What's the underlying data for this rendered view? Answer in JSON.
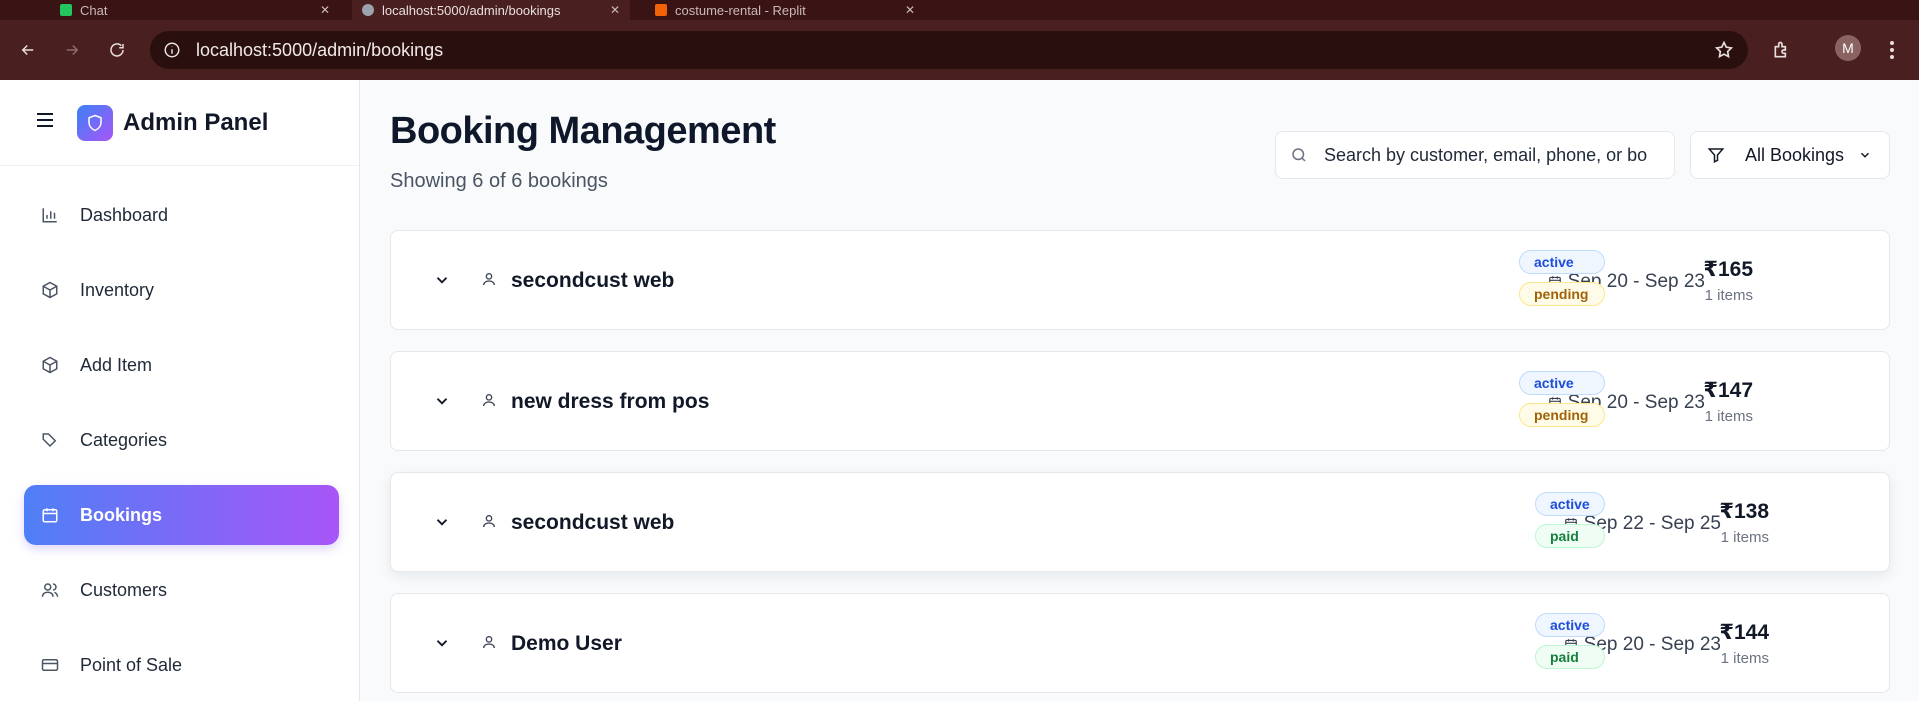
{
  "browser": {
    "tabs": [
      {
        "title": "Chat"
      },
      {
        "title": "localhost:5000/admin/bookings"
      },
      {
        "title": "costume-rental - Replit"
      }
    ],
    "url": "localhost:5000/admin/bookings",
    "profile_initial": "M"
  },
  "sidebar": {
    "brand": "Admin Panel",
    "items": [
      {
        "label": "Dashboard",
        "icon": "bar-chart-icon"
      },
      {
        "label": "Inventory",
        "icon": "package-icon"
      },
      {
        "label": "Add Item",
        "icon": "package-icon"
      },
      {
        "label": "Categories",
        "icon": "tags-icon"
      },
      {
        "label": "Bookings",
        "icon": "calendar-icon",
        "active": true
      },
      {
        "label": "Customers",
        "icon": "users-icon"
      },
      {
        "label": "Point of Sale",
        "icon": "credit-card-icon"
      }
    ]
  },
  "header": {
    "title": "Booking Management",
    "subtitle": "Showing 6 of 6 bookings",
    "search_placeholder": "Search by customer, email, phone, or bo",
    "filter_label": "All Bookings"
  },
  "bookings": [
    {
      "customer": "secondcust web",
      "dates": "Sep 20 - Sep 23",
      "amount": "₹165",
      "items": "1 items",
      "status": "active",
      "payment": "pending"
    },
    {
      "customer": "new dress from pos",
      "dates": "Sep 20 - Sep 23",
      "amount": "₹147",
      "items": "1 items",
      "status": "active",
      "payment": "pending"
    },
    {
      "customer": "secondcust web",
      "dates": "Sep 22 - Sep 25",
      "amount": "₹138",
      "items": "1 items",
      "status": "active",
      "payment": "paid"
    },
    {
      "customer": "Demo User",
      "dates": "Sep 20 - Sep 23",
      "amount": "₹144",
      "items": "1 items",
      "status": "active",
      "payment": "paid"
    }
  ],
  "colors": {
    "accent_start": "#4f7ff6",
    "accent_end": "#a855f7",
    "browser_chrome": "#4a1f1f"
  }
}
